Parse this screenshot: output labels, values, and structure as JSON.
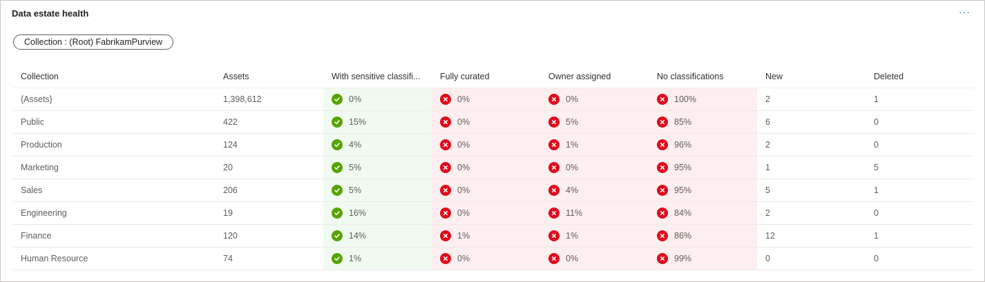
{
  "card": {
    "title": "Data estate health",
    "more_label": "···",
    "filter_label": "Collection : (Root) FabrikamPurview"
  },
  "colors": {
    "good_bg": "#f1faf0",
    "bad_bg": "#fdeef0",
    "ok_icon": "#57a300",
    "error_icon": "#e00b1c",
    "accent": "#0078d4"
  },
  "table": {
    "headers": [
      "Collection",
      "Assets",
      "With sensitive classifi...",
      "Fully curated",
      "Owner assigned",
      "No classifications",
      "New",
      "Deleted"
    ],
    "rows": [
      {
        "collection": "{Assets}",
        "assets": "1,398,612",
        "sensitive": "0%",
        "curated": "0%",
        "owner": "0%",
        "no_class": "100%",
        "new": "2",
        "deleted": "1"
      },
      {
        "collection": "Public",
        "assets": "422",
        "sensitive": "15%",
        "curated": "0%",
        "owner": "5%",
        "no_class": "85%",
        "new": "6",
        "deleted": "0"
      },
      {
        "collection": "Production",
        "assets": "124",
        "sensitive": "4%",
        "curated": "0%",
        "owner": "1%",
        "no_class": "96%",
        "new": "2",
        "deleted": "0"
      },
      {
        "collection": "Marketing",
        "assets": "20",
        "sensitive": "5%",
        "curated": "0%",
        "owner": "0%",
        "no_class": "95%",
        "new": "1",
        "deleted": "5"
      },
      {
        "collection": "Sales",
        "assets": "206",
        "sensitive": "5%",
        "curated": "0%",
        "owner": "4%",
        "no_class": "95%",
        "new": "5",
        "deleted": "1"
      },
      {
        "collection": "Engineering",
        "assets": "19",
        "sensitive": "16%",
        "curated": "0%",
        "owner": "11%",
        "no_class": "84%",
        "new": "2",
        "deleted": "0"
      },
      {
        "collection": "Finance",
        "assets": "120",
        "sensitive": "14%",
        "curated": "1%",
        "owner": "1%",
        "no_class": "86%",
        "new": "12",
        "deleted": "1"
      },
      {
        "collection": "Human Resource",
        "assets": "74",
        "sensitive": "1%",
        "curated": "0%",
        "owner": "0%",
        "no_class": "99%",
        "new": "0",
        "deleted": "0"
      }
    ]
  }
}
